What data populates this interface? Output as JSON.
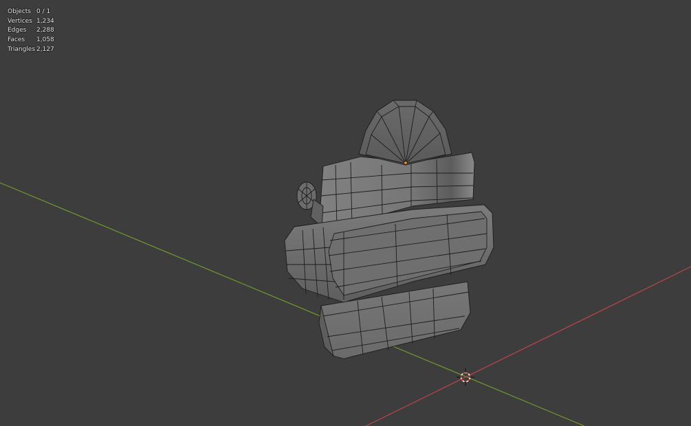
{
  "viewport": {
    "background": "#3d3d3d",
    "stats": [
      {
        "label": "Objects",
        "value": "0 / 1"
      },
      {
        "label": "Vertices",
        "value": "1,234"
      },
      {
        "label": "Edges",
        "value": "2,288"
      },
      {
        "label": "Faces",
        "value": "1,058"
      },
      {
        "label": "Triangles",
        "value": "2,127"
      }
    ],
    "axis_colors": {
      "x": "#c0444a",
      "y": "#6f9a2c"
    },
    "mesh_colors": {
      "face": "#6e6e6e",
      "wire": "#1a1a1a",
      "selected_vertex": "#ff8c1a"
    },
    "icons": [
      "3d-cursor-icon",
      "origin-point-icon"
    ]
  }
}
